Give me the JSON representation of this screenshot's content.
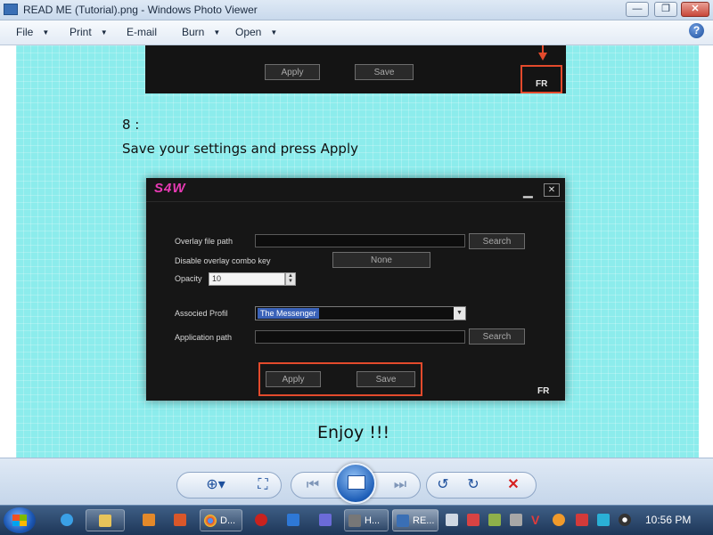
{
  "window": {
    "title": "READ ME (Tutorial).png - Windows Photo Viewer",
    "buttons": {
      "minimize": "—",
      "maximize": "❐",
      "close": "✕"
    }
  },
  "menu": {
    "items": [
      "File",
      "Print",
      "E-mail",
      "Burn",
      "Open"
    ],
    "help_icon": "?"
  },
  "tutorial": {
    "top_snippet": {
      "apply": "Apply",
      "save": "Save",
      "fr": "FR"
    },
    "step_number": "8 :",
    "step_text": "Save your settings and press Apply",
    "dialog": {
      "logo": "S4W",
      "overlay_label": "Overlay file path",
      "overlay_search": "Search",
      "disable_label": "Disable overlay combo key",
      "disable_value": "None",
      "opacity_label": "Opacity",
      "opacity_value": "10",
      "profile_label": "Associed Profil",
      "profile_value": "The Messenger",
      "apppath_label": "Application path",
      "apppath_search": "Search",
      "apply": "Apply",
      "save": "Save",
      "fr": "FR"
    },
    "closing_text": "Enjoy !!!"
  },
  "controls": {
    "icons": [
      "zoom-icon",
      "actual-size-icon",
      "previous-icon",
      "slideshow-icon",
      "next-icon",
      "rotate-left-icon",
      "rotate-right-icon",
      "delete-icon"
    ]
  },
  "taskbar": {
    "items": [
      {
        "label": "D...",
        "icon": "chrome-icon"
      },
      {
        "label": "H...",
        "icon": "app-icon"
      },
      {
        "label": "RE...",
        "icon": "photo-viewer-icon"
      }
    ],
    "clock": "10:56 PM"
  },
  "colors": {
    "accent": "#1d4f9c",
    "highlight_red": "#e34a2c",
    "background_cyan": "#8cecec"
  }
}
